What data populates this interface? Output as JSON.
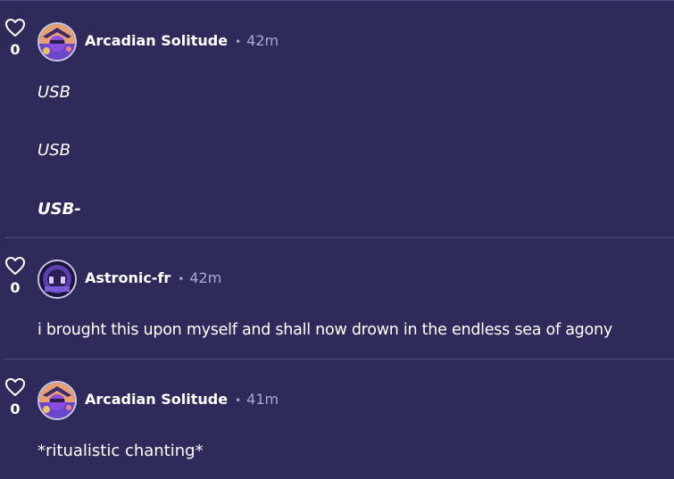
{
  "comments": [
    {
      "username": "Arcadian Solitude",
      "time": "42m",
      "likes": "0",
      "lines": [
        "USB",
        "USB",
        "USB-"
      ]
    },
    {
      "username": "Astronic-fr",
      "time": "42m",
      "likes": "0",
      "lines": [
        "i brought this upon myself and shall now drown in the endless sea of agony"
      ]
    },
    {
      "username": "Arcadian Solitude",
      "time": "41m",
      "likes": "0",
      "lines": [
        "*ritualistic chanting*"
      ]
    }
  ],
  "separator": "•",
  "colors": {
    "background": "#2e2b5b",
    "divider": "#4f4c7e",
    "meta_text": "#a9a6cf",
    "text": "#ffffff"
  },
  "icons": {
    "like": "heart-icon"
  }
}
